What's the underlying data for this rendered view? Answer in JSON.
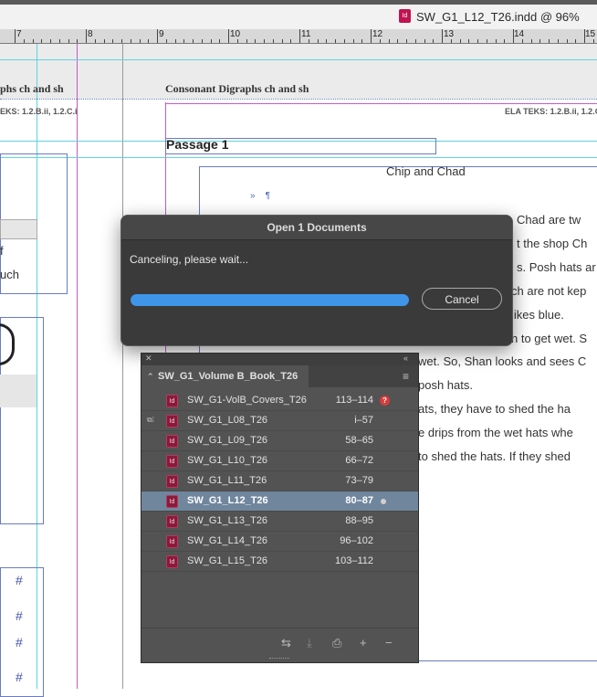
{
  "window": {
    "doc_icon": "Id",
    "title": "SW_G1_L12_T26.indd @ 96%"
  },
  "ruler": {
    "labels": [
      "7",
      "8",
      "9",
      "10",
      "11",
      "12",
      "13",
      "14",
      "15"
    ]
  },
  "page": {
    "left_heading": "phs ch and sh",
    "left_teks": "EKS: 1.2.B.ii, 1.2.C.i",
    "heading": "Consonant Digraphs ch and sh",
    "teks": "ELA TEKS: 1.2.B.ii, 1.2.C.i",
    "passage_title": "Passage 1",
    "story_title": "Chip and Chad",
    "body_lines": [
      "Chad are tw",
      "t the shop Ch",
      "s. Posh hats ar",
      "ch are not kep",
      "likes blue.",
      "n to get wet. S",
      "wet. So, Shan looks and sees C",
      "posh hats.",
      "ats, they have to shed the ha",
      "e drips from the wet hats whe",
      "to shed the hats. If they shed"
    ],
    "left_cells": [
      "f",
      "uch"
    ],
    "hash_marks": [
      "#",
      "#",
      "#",
      "#"
    ]
  },
  "dialog": {
    "title": "Open 1 Documents",
    "message": "Canceling, please wait...",
    "progress": 1.0,
    "cancel_label": "Cancel"
  },
  "book_panel": {
    "tab_label": "SW_G1_Volume B_Book_T26",
    "docs": [
      {
        "name": "SW_G1-VolB_Covers_T26",
        "pages": "113–114",
        "status": "missing"
      },
      {
        "name": "SW_G1_L08_T26",
        "pages": "i–57",
        "status": "sync-source"
      },
      {
        "name": "SW_G1_L09_T26",
        "pages": "58–65",
        "status": ""
      },
      {
        "name": "SW_G1_L10_T26",
        "pages": "66–72",
        "status": ""
      },
      {
        "name": "SW_G1_L11_T26",
        "pages": "73–79",
        "status": ""
      },
      {
        "name": "SW_G1_L12_T26",
        "pages": "80–87",
        "status": "open"
      },
      {
        "name": "SW_G1_L13_T26",
        "pages": "88–95",
        "status": ""
      },
      {
        "name": "SW_G1_L14_T26",
        "pages": "96–102",
        "status": ""
      },
      {
        "name": "SW_G1_L15_T26",
        "pages": "103–112",
        "status": ""
      }
    ],
    "selected_index": 5,
    "footer_icons": [
      "synchronize-icon",
      "save-book-icon",
      "print-book-icon",
      "add-document-icon",
      "remove-document-icon"
    ]
  },
  "colors": {
    "accent_progress": "#3f95e8",
    "selection": "#6f869d",
    "guide_cyan": "#5fd3e0",
    "margin_magenta": "#c45ac8",
    "doc_icon": "#c0134f"
  }
}
